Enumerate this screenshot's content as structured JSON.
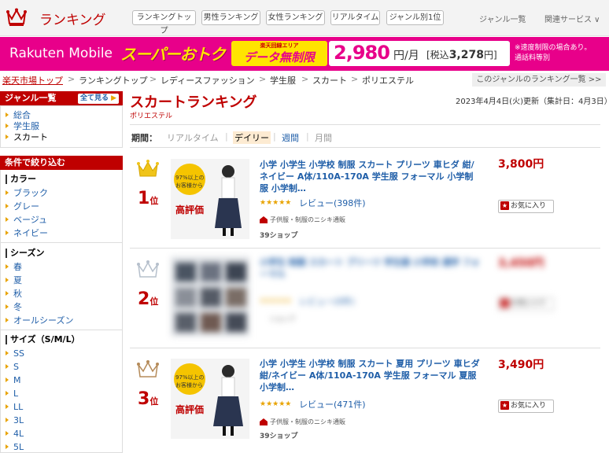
{
  "header": {
    "title": "ランキング",
    "nav": [
      "ランキングトップ",
      "男性ランキング",
      "女性ランキング",
      "リアルタイム",
      "ジャンル別1位"
    ],
    "links": [
      "ジャンル一覧",
      "関連サービス ∨"
    ]
  },
  "banner": {
    "brand": "Rakuten Mobile",
    "promo": "スーパーおトク",
    "data_small": "楽天回線エリア",
    "data_main": "データ無制限",
    "price": "2,980",
    "price_unit": "円/月",
    "price_tax_label": "[税込",
    "price_tax_value": "3,278",
    "price_tax_unit": "円]",
    "note_line1": "※速度制限の場合あり。",
    "note_line2": "通話料等別"
  },
  "breadcrumb": [
    "楽天市場トップ",
    "ランキングトップ",
    "レディースファッション",
    "学生服",
    "スカート",
    "ポリエステル"
  ],
  "genre_link": "このジャンルのランキング一覧 >>",
  "sidebar": {
    "genre_head": "ジャンル一覧",
    "see_all": "全て見る",
    "genres": [
      "総合",
      "学生服",
      "スカート"
    ],
    "filter_head": "条件で絞り込む",
    "color_head": "カラー",
    "colors": [
      "ブラック",
      "グレー",
      "ベージュ",
      "ネイビー"
    ],
    "season_head": "シーズン",
    "seasons": [
      "春",
      "夏",
      "秋",
      "冬",
      "オールシーズン"
    ],
    "size_head": "サイズ（S/M/L）",
    "sizes": [
      "SS",
      "S",
      "M",
      "L",
      "LL",
      "3L",
      "4L",
      "5L"
    ]
  },
  "main": {
    "title": "スカートランキング",
    "subtitle": "ポリエステル",
    "update": "2023年4月4日(火)更新（集計日：4月3日）",
    "period_label": "期間：",
    "periods": [
      "リアルタイム",
      "デイリー",
      "週間",
      "月間"
    ],
    "active_period": "デイリー"
  },
  "items": [
    {
      "rank": "1",
      "rank_suffix": "位",
      "title": "小学 小学生 小学校 制服 スカート プリーツ 車ヒダ 紺/ネイビー A体/110A-170A 学生服 フォーマル 小学制服 小学制…",
      "stars": "★★★★★",
      "reviews": "レビュー(398件)",
      "shop": "子供服・制服のニシキ通販",
      "points": "39ショップ",
      "price": "3,800円",
      "fav": "お気に入り",
      "thumb_line1": "97%以上の",
      "thumb_line2": "お客様から",
      "thumb_line3": "高評価"
    },
    {
      "rank": "2",
      "rank_suffix": "位",
      "title": "小学生 制服 スカート プリーツ 学生服 小学校 通学 フォーマル",
      "stars": "★★★★★",
      "reviews": "レビュー(0件)",
      "shop": "ショップ",
      "price": "3,450円",
      "fav": "お気に入り"
    },
    {
      "rank": "3",
      "rank_suffix": "位",
      "title": "小学 小学生 小学校 制服 スカート 夏用 プリーツ 車ヒダ 紺/ネイビー A体/110A-170A 学生服 フォーマル 夏服 小学制…",
      "stars": "★★★★★",
      "reviews": "レビュー(471件)",
      "shop": "子供服・制服のニシキ通販",
      "points": "39ショップ",
      "price": "3,490円",
      "fav": "お気に入り",
      "thumb_line1": "97%以上の",
      "thumb_line2": "お客様から",
      "thumb_line3": "高評価"
    }
  ],
  "colors": {
    "brand_red": "#bf0000",
    "banner_pink": "#e8008a",
    "link_blue": "#1f5ea8",
    "gold": "#e8a300"
  }
}
